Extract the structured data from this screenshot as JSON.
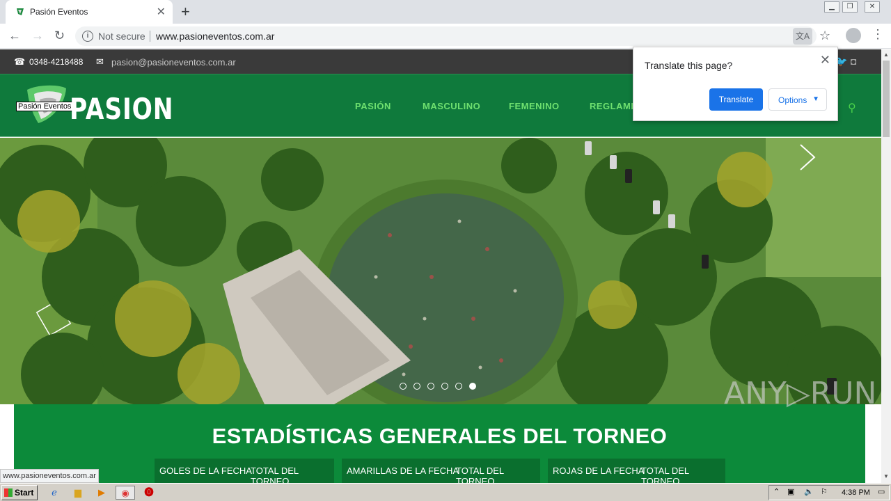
{
  "browser": {
    "tab_title": "Pasión Eventos",
    "tab_close": "✕",
    "new_tab": "+",
    "security_label": "Not secure",
    "url": "www.pasioneventos.com.ar",
    "status_url": "www.pasioneventos.com.ar"
  },
  "topbar": {
    "phone": "0348-4218488",
    "email": "pasion@pasioneventos.com.ar"
  },
  "header": {
    "logo_alt": "Pasión Eventos",
    "logo_text": "PASION",
    "nav": [
      "PASIÓN",
      "MASCULINO",
      "FEMENINO",
      "REGLAMENTO"
    ]
  },
  "stats": {
    "title": "ESTADÍSTICAS GENERALES DEL TORNEO",
    "groups": [
      {
        "left": "GOLES DE LA FECHA",
        "right": "TOTAL DEL TORNEO"
      },
      {
        "left": "AMARILLAS DE LA FECHA",
        "right": "TOTAL DEL TORNEO"
      },
      {
        "left": "ROJAS DE LA FECHA",
        "right": "TOTAL DEL TORNEO"
      }
    ]
  },
  "translate_popup": {
    "question": "Translate this page?",
    "translate_label": "Translate",
    "options_label": "Options"
  },
  "watermark": "ANY▷RUN",
  "taskbar": {
    "start_label": "Start",
    "clock": "4:38 PM"
  },
  "colors": {
    "header_green": "#0f7a3c",
    "stats_green": "#0c8a3a",
    "nav_green": "#6fe06f",
    "translate_blue": "#1a73e8"
  },
  "carousel": {
    "slides": 6,
    "active": 6
  }
}
